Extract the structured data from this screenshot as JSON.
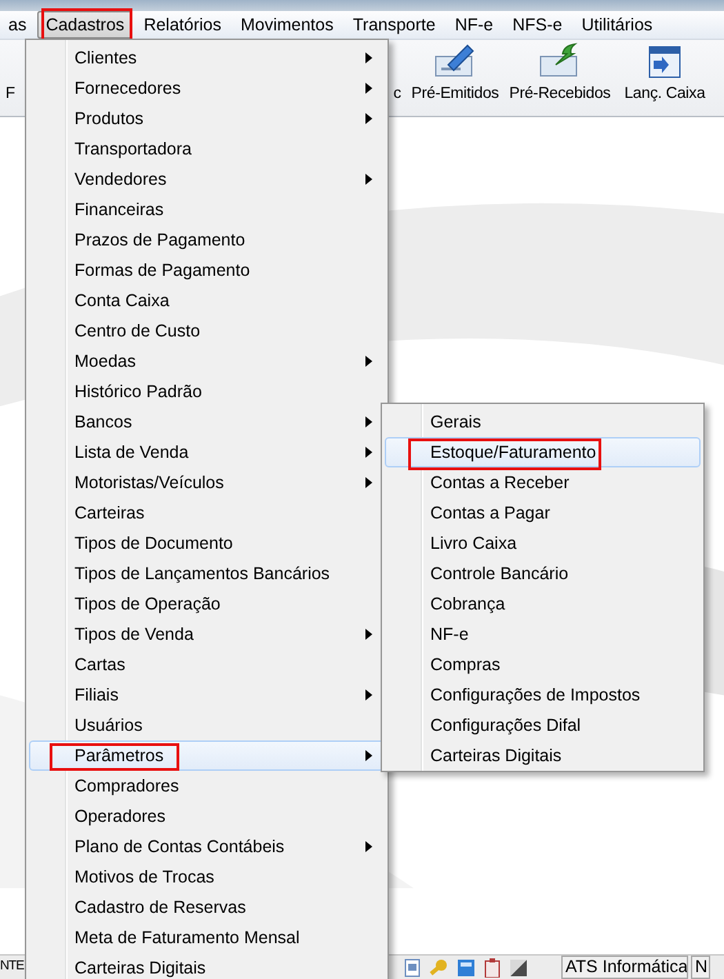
{
  "menu_bar": [
    {
      "label": "as",
      "selected": false,
      "marked": false
    },
    {
      "label": "Cadastros",
      "selected": true,
      "marked": true
    },
    {
      "label": "Relatórios",
      "selected": false,
      "marked": false
    },
    {
      "label": "Movimentos",
      "selected": false,
      "marked": false
    },
    {
      "label": "Transporte",
      "selected": false,
      "marked": false
    },
    {
      "label": "NF-e",
      "selected": false,
      "marked": false
    },
    {
      "label": "NFS-e",
      "selected": false,
      "marked": false
    },
    {
      "label": "Utilitários",
      "selected": false,
      "marked": false
    }
  ],
  "toolbar": [
    {
      "label": "F",
      "kind": "cut"
    },
    {
      "label": "c",
      "kind": "cut"
    },
    {
      "label": "Pré-Emitidos",
      "kind": "pen"
    },
    {
      "label": "Pré-Recebidos",
      "kind": "arrow"
    },
    {
      "label": "Lanç. Caixa",
      "kind": "calendar"
    }
  ],
  "cadastros_menu": {
    "items": [
      {
        "label": "Clientes",
        "has_submenu": true,
        "selected": false,
        "marked": false
      },
      {
        "label": "Fornecedores",
        "has_submenu": true,
        "selected": false,
        "marked": false
      },
      {
        "label": "Produtos",
        "has_submenu": true,
        "selected": false,
        "marked": false
      },
      {
        "label": "Transportadora",
        "has_submenu": false,
        "selected": false,
        "marked": false
      },
      {
        "label": "Vendedores",
        "has_submenu": true,
        "selected": false,
        "marked": false
      },
      {
        "label": "Financeiras",
        "has_submenu": false,
        "selected": false,
        "marked": false
      },
      {
        "label": "Prazos de Pagamento",
        "has_submenu": false,
        "selected": false,
        "marked": false
      },
      {
        "label": "Formas de Pagamento",
        "has_submenu": false,
        "selected": false,
        "marked": false
      },
      {
        "label": "Conta Caixa",
        "has_submenu": false,
        "selected": false,
        "marked": false
      },
      {
        "label": "Centro de Custo",
        "has_submenu": false,
        "selected": false,
        "marked": false
      },
      {
        "label": "Moedas",
        "has_submenu": true,
        "selected": false,
        "marked": false
      },
      {
        "label": "Histórico Padrão",
        "has_submenu": false,
        "selected": false,
        "marked": false
      },
      {
        "label": "Bancos",
        "has_submenu": true,
        "selected": false,
        "marked": false
      },
      {
        "label": "Lista de Venda",
        "has_submenu": true,
        "selected": false,
        "marked": false
      },
      {
        "label": "Motoristas/Veículos",
        "has_submenu": true,
        "selected": false,
        "marked": false
      },
      {
        "label": "Carteiras",
        "has_submenu": false,
        "selected": false,
        "marked": false
      },
      {
        "label": "Tipos de Documento",
        "has_submenu": false,
        "selected": false,
        "marked": false
      },
      {
        "label": "Tipos de Lançamentos Bancários",
        "has_submenu": false,
        "selected": false,
        "marked": false
      },
      {
        "label": "Tipos de Operação",
        "has_submenu": false,
        "selected": false,
        "marked": false
      },
      {
        "label": "Tipos de Venda",
        "has_submenu": true,
        "selected": false,
        "marked": false
      },
      {
        "label": "Cartas",
        "has_submenu": false,
        "selected": false,
        "marked": false
      },
      {
        "label": "Filiais",
        "has_submenu": true,
        "selected": false,
        "marked": false
      },
      {
        "label": "Usuários",
        "has_submenu": false,
        "selected": false,
        "marked": false
      },
      {
        "label": "Parâmetros",
        "has_submenu": true,
        "selected": true,
        "marked": true
      },
      {
        "label": "Compradores",
        "has_submenu": false,
        "selected": false,
        "marked": false
      },
      {
        "label": "Operadores",
        "has_submenu": false,
        "selected": false,
        "marked": false
      },
      {
        "label": "Plano de Contas Contábeis",
        "has_submenu": true,
        "selected": false,
        "marked": false
      },
      {
        "label": "Motivos de Trocas",
        "has_submenu": false,
        "selected": false,
        "marked": false
      },
      {
        "label": "Cadastro de Reservas",
        "has_submenu": false,
        "selected": false,
        "marked": false
      },
      {
        "label": "Meta de Faturamento Mensal",
        "has_submenu": false,
        "selected": false,
        "marked": false
      },
      {
        "label": "Carteiras Digitais",
        "has_submenu": false,
        "selected": false,
        "marked": false
      }
    ]
  },
  "parametros_submenu": {
    "items": [
      {
        "label": "Gerais",
        "selected": false,
        "marked": false
      },
      {
        "label": "Estoque/Faturamento",
        "selected": true,
        "marked": true
      },
      {
        "label": "Contas a Receber",
        "selected": false,
        "marked": false
      },
      {
        "label": "Contas a Pagar",
        "selected": false,
        "marked": false
      },
      {
        "label": "Livro Caixa",
        "selected": false,
        "marked": false
      },
      {
        "label": "Controle Bancário",
        "selected": false,
        "marked": false
      },
      {
        "label": "Cobrança",
        "selected": false,
        "marked": false
      },
      {
        "label": "NF-e",
        "selected": false,
        "marked": false
      },
      {
        "label": "Compras",
        "selected": false,
        "marked": false
      },
      {
        "label": "Configurações de Impostos",
        "selected": false,
        "marked": false
      },
      {
        "label": "Configurações Difal",
        "selected": false,
        "marked": false
      },
      {
        "label": "Carteiras Digitais",
        "selected": false,
        "marked": false
      }
    ]
  },
  "status_bar": [
    {
      "kind": "text",
      "text": "NTE"
    },
    {
      "kind": "icons"
    },
    {
      "kind": "text",
      "text": "ATS Informática"
    },
    {
      "kind": "text",
      "text": "N"
    }
  ]
}
